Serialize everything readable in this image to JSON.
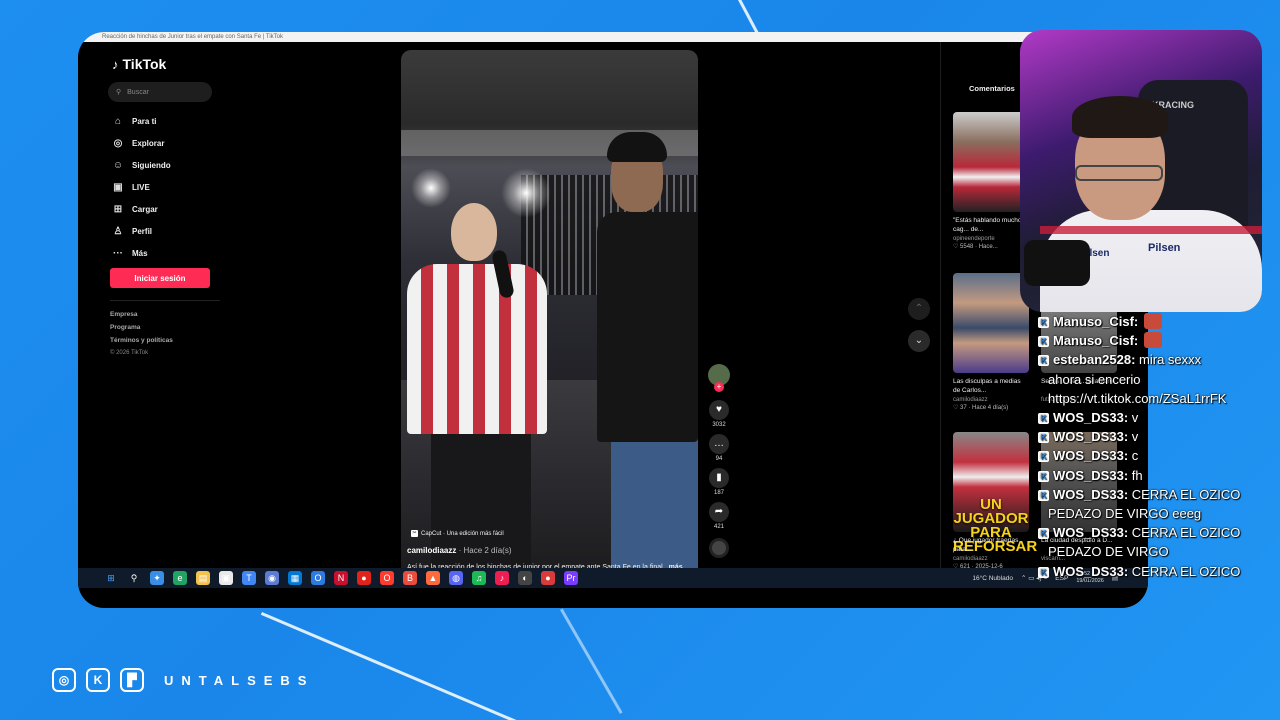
{
  "browser": {
    "tab_title": "Reacción de hinchas de Junior tras el empate con Santa Fe | TikTok"
  },
  "tiktok": {
    "logo": "TikTok",
    "search_placeholder": "Buscar",
    "nav": [
      {
        "label": "Para ti",
        "icon": "home-icon",
        "glyph": "⌂"
      },
      {
        "label": "Explorar",
        "icon": "compass-icon",
        "glyph": "◎"
      },
      {
        "label": "Siguiendo",
        "icon": "following-icon",
        "glyph": "☺"
      },
      {
        "label": "LIVE",
        "icon": "live-icon",
        "glyph": "▣"
      },
      {
        "label": "Cargar",
        "icon": "upload-icon",
        "glyph": "⊞"
      },
      {
        "label": "Perfil",
        "icon": "profile-icon",
        "glyph": "♙"
      },
      {
        "label": "Más",
        "icon": "more-icon",
        "glyph": "···"
      }
    ],
    "login_label": "Iniciar sesión",
    "footer": [
      "Empresa",
      "Programa",
      "Términos y políticas"
    ],
    "copyright": "© 2026 TikTok",
    "video": {
      "capcut": "CapCut · Una edición más fácil",
      "author": "camilodiaazz",
      "posted": "· Hace 2 día(s)",
      "caption": "Así fue la reacción de los hinchas de junior por el empate ante Santa Fe en la final",
      "more": "más",
      "progress": 0.32
    },
    "actions": {
      "likes": "3032",
      "comments": "94",
      "saves": "187",
      "shares": "421"
    },
    "comments_tab": "Comentarios",
    "related": [
      {
        "title": "\"Estás hablando mucho, cag... de...",
        "user": "opineendeporte",
        "meta": "♡ 5548 · Hace...",
        "overlay": ""
      },
      {
        "title": "",
        "user": "",
        "meta": "",
        "overlay": ""
      },
      {
        "title": "Las disculpas a medias de Carlos...",
        "user": "camilodiaazz",
        "meta": "♡ 37 · Hace 4 día(s)",
        "overlay": ""
      },
      {
        "title": "Sebas ... del ... delantero",
        "user": "futboleros.cig",
        "meta": "",
        "overlay": ""
      },
      {
        "title": "¿ Que jugador traerías para...",
        "user": "camilodiaazz",
        "meta": "♡ 621 · 2025-12-6",
        "overlay": "UN JUGADOR PARA REFORSAR"
      },
      {
        "title": "La ciudad despidió a D...",
        "user": "viscarri...",
        "meta": "",
        "overlay": ""
      }
    ]
  },
  "taskbar": {
    "weather": "16°C Nublado",
    "lang": "ESP",
    "time": "12:52 a. m.",
    "date": "19/01/2026",
    "icon_colors": [
      "#4aa3ff",
      "#fff",
      "#3a8ee6",
      "#1fa463",
      "#f2c14e",
      "#e9e9e9",
      "#4285f4",
      "#5b7bd5",
      "#0078d4",
      "#2d7be0",
      "#c8102e",
      "#e2231a",
      "#ff3b30",
      "#e74c3c",
      "#ff6a3d",
      "#5865f2",
      "#1db954",
      "#ee1d52",
      "#444",
      "#d93b3b",
      "#7a3cff"
    ]
  },
  "webcam": {
    "chair_text": "KRACING",
    "brand": "Pilsen",
    "brand2": "Pilsen"
  },
  "chat": [
    {
      "user": "Manuso_Cisf",
      "text": "",
      "emote": true,
      "badge": "K"
    },
    {
      "user": "Manuso_Cisf",
      "text": "",
      "emote": true,
      "badge": "K"
    },
    {
      "user": "esteban2528",
      "text": " mira sexxx",
      "emote": false,
      "badge": "K"
    },
    {
      "user": "",
      "text": "ahora si encerio",
      "emote": false,
      "badge": ""
    },
    {
      "user": "",
      "text": "https://vt.tiktok.com/ZSaL1rrFK",
      "emote": false,
      "badge": ""
    },
    {
      "user": "WOS_DS33",
      "text": " v",
      "emote": false,
      "badge": "K"
    },
    {
      "user": "WOS_DS33",
      "text": " v",
      "emote": false,
      "badge": "K"
    },
    {
      "user": "WOS_DS33",
      "text": " c",
      "emote": false,
      "badge": "K"
    },
    {
      "user": "WOS_DS33",
      "text": " fh",
      "emote": false,
      "badge": "K"
    },
    {
      "user": "WOS_DS33",
      "text": " CERRA EL OZICO",
      "emote": false,
      "badge": "K"
    },
    {
      "user": "",
      "text": "PEDAZO DE VIRGO eeeg",
      "emote": false,
      "badge": ""
    },
    {
      "user": "WOS_DS33",
      "text": " CERRA EL OZICO",
      "emote": false,
      "badge": "K"
    },
    {
      "user": "",
      "text": "PEDAZO DE VIRGO",
      "emote": false,
      "badge": ""
    },
    {
      "user": "WOS_DS33",
      "text": " CERRA EL OZICO",
      "emote": false,
      "badge": "K"
    }
  ],
  "socials": {
    "brand": "UNTALSEBS",
    "icons": [
      "instagram-icon",
      "kick-icon",
      "twitch-icon"
    ]
  }
}
